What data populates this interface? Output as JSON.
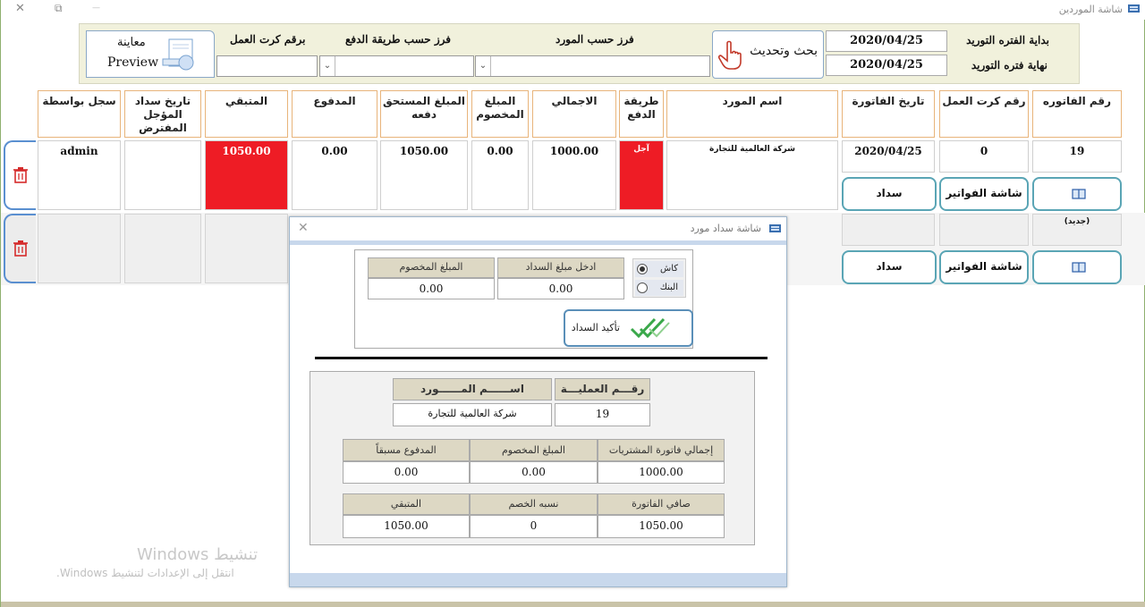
{
  "window": {
    "title": "شاشة الموردين",
    "close_glyph": "✕",
    "restore_glyph": "⧉",
    "minimize_glyph": "—"
  },
  "filters": {
    "period_start_label": "بداية الفتره التوريد",
    "period_end_label": "نهاية فتره التوريد",
    "period_start_value": "2020/04/25",
    "period_end_value": "2020/04/25",
    "search_button_label": "بحث وتحديث",
    "sort_supplier_label": "فرز حسب المورد",
    "sort_payment_label": "فرز حسب طريقة الدفع",
    "worker_card_label": "برقم كرت العمل",
    "preview_label_ar": "معاينة",
    "preview_label_en": "Preview",
    "dropdown_arrow": "⌄"
  },
  "table": {
    "headers": {
      "invoice_no": "رقم الفاتوره",
      "work_card": "رقم كرت العمل",
      "invoice_date": "تاريخ الفاتورة",
      "supplier": "اسم المورد",
      "payment_method": "طريقة الدفع",
      "total": "الاجمالي",
      "discount": "المبلغ المخصوم",
      "due_amount": "المبلغ المستحق دفعه",
      "paid": "المدفوع",
      "remaining": "المتبقي",
      "deferred_date": "تاريخ سداد المؤجل المفترض",
      "recorded_by": "سجل بواسطة"
    },
    "row1": {
      "invoice_no": "19",
      "work_card": "0",
      "invoice_date": "2020/04/25",
      "supplier": "شركة العالمية للتجارة",
      "payment_method": "آجل",
      "total": "1000.00",
      "discount": "0.00",
      "due_amount": "1050.00",
      "paid": "0.00",
      "remaining": "1050.00",
      "deferred_date": "",
      "recorded_by": "admin",
      "invoices_button": "شاشة الفواتير",
      "pay_button": "سداد"
    },
    "row2": {
      "invoice_no": "(جديد)",
      "invoices_button": "شاشة الفواتير",
      "pay_button": "سداد"
    }
  },
  "dialog": {
    "title": "شاشة سداد مورد",
    "close_glyph": "✕",
    "cash_label": "كاش",
    "bank_label": "البنك",
    "enter_amount_label": "ادخل مبلغ السداد",
    "enter_amount_value": "0.00",
    "discount_label": "المبلغ المخصوم",
    "discount_value": "0.00",
    "confirm_label": "تأكيد السداد",
    "operation_no_label": "رقـــم العمليـــة",
    "operation_no_value": "19",
    "supplier_name_label": "اســــــم المــــــورد",
    "supplier_name_value": "شركة العالمية للتجارة",
    "purchase_total_label": "إجمالي فاتورة المشتريات",
    "purchase_total_value": "1000.00",
    "discounted_label": "المبلغ المخصوم",
    "discounted_value": "0.00",
    "prepaid_label": "المدفوع مسبقاً",
    "prepaid_value": "0.00",
    "net_invoice_label": "صافي الفاتورة",
    "net_invoice_value": "1050.00",
    "discount_rate_label": "نسبه الخصم",
    "discount_rate_value": "0",
    "remaining_label": "المتبقي",
    "remaining_value": "1050.00"
  },
  "watermark": {
    "line1": "تنشيط Windows",
    "line2": "انتقل إلى الإعدادات لتنشيط Windows."
  },
  "colors": {
    "accent_red": "#ee1c25",
    "panel_bg": "#f1f1dc",
    "header_border": "#e8b47a",
    "button_border": "#5aa5b5"
  }
}
